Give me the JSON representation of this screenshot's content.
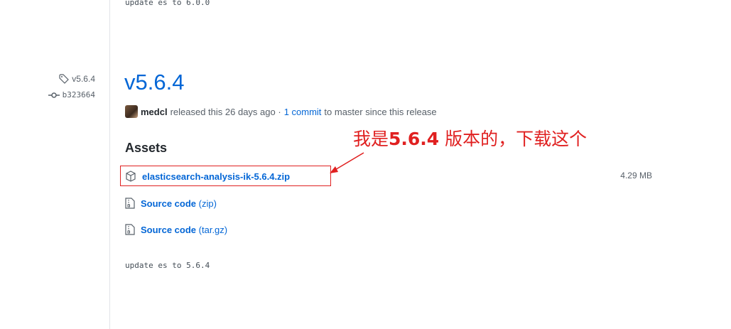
{
  "previous_release": {
    "note": "update es to 6.0.0"
  },
  "release": {
    "tag": "v5.6.4",
    "commit": "b323664",
    "title": "v5.6.4",
    "author": "medcl",
    "released_text": "released this 26 days ago ·",
    "commit_count_link": "1 commit",
    "branch_text": "to master since this release",
    "assets_heading": "Assets",
    "assets": [
      {
        "name": "elasticsearch-analysis-ik-5.6.4.zip",
        "size": "4.29 MB",
        "icon": "package-icon"
      },
      {
        "name": "Source code",
        "suffix": "(zip)",
        "icon": "file-zip-icon"
      },
      {
        "name": "Source code",
        "suffix": "(tar.gz)",
        "icon": "file-zip-icon"
      }
    ],
    "note": "update es to 5.6.4"
  },
  "annotation": {
    "prefix": "我是",
    "bold": "5.6.4",
    "suffix": " 版本的，下载这个",
    "color": "#e02020"
  },
  "colors": {
    "link": "#0366d6",
    "annotation": "#e02020"
  }
}
